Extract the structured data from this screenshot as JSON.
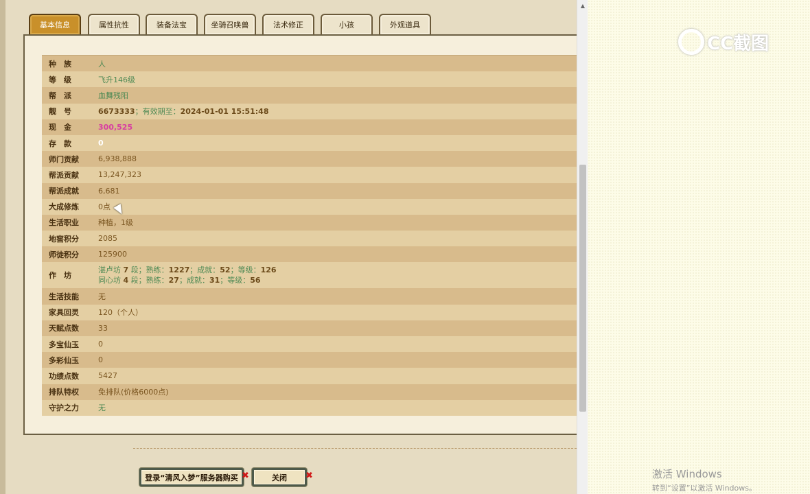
{
  "tabs": [
    {
      "label": "基本信息",
      "active": true
    },
    {
      "label": "属性抗性",
      "active": false
    },
    {
      "label": "装备法宝",
      "active": false
    },
    {
      "label": "坐骑召唤兽",
      "active": false
    },
    {
      "label": "法术修正",
      "active": false
    },
    {
      "label": "小孩",
      "active": false
    },
    {
      "label": "外观道具",
      "active": false
    }
  ],
  "info": {
    "race": {
      "label": "种　族",
      "value": "人"
    },
    "level": {
      "label": "等　级",
      "value": "飞升146级"
    },
    "faction": {
      "label": "帮　派",
      "value": "血舞残阳"
    },
    "id": {
      "label": "靓　号",
      "number": "6673333",
      "sep": "；",
      "expiry_label": "有效期至：",
      "expiry": "2024-01-01 15:51:48"
    },
    "cash": {
      "label": "现　金",
      "value": "300,525"
    },
    "deposit": {
      "label": "存　款",
      "value": "0"
    },
    "school_contrib": {
      "label": "师门贡献",
      "value": "6,938,888"
    },
    "faction_contrib": {
      "label": "帮派贡献",
      "value": "13,247,323"
    },
    "faction_achieve": {
      "label": "帮派成就",
      "value": "6,681"
    },
    "cultivation": {
      "label": "大成修炼",
      "value": "0点"
    },
    "life_job": {
      "label": "生活职业",
      "value": "种植，1级"
    },
    "cellar_points": {
      "label": "地窖积分",
      "value": "2085"
    },
    "apprentice_points": {
      "label": "师徒积分",
      "value": "125900"
    },
    "workshop": {
      "label": "作　坊",
      "lines": [
        {
          "name": "湛卢坊",
          "num": "7",
          "seg": "段；熟练：",
          "skill": "1227",
          "ach_label": "；成就：",
          "ach": "52",
          "lvl_label": "；等级：",
          "lvl": "126"
        },
        {
          "name": "同心坊",
          "num": "4",
          "seg": "段；熟练：",
          "skill": "27",
          "ach_label": "；成就：",
          "ach": "31",
          "lvl_label": "；等级：",
          "lvl": "56"
        }
      ]
    },
    "life_skill": {
      "label": "生活技能",
      "value": "无"
    },
    "furniture": {
      "label": "家具回灵",
      "value": "120（个人）"
    },
    "talent": {
      "label": "天赋点数",
      "value": "33"
    },
    "duobao": {
      "label": "多宝仙玉",
      "value": "0"
    },
    "duocai": {
      "label": "多彩仙玉",
      "value": "0"
    },
    "merit": {
      "label": "功绩点数",
      "value": "5427"
    },
    "queue": {
      "label": "排队特权",
      "value": "免排队(价格6000点)"
    },
    "guardian": {
      "label": "守护之力",
      "value": "无"
    }
  },
  "buttons": {
    "login": "登录“清风入梦”服务器购买",
    "close": "关闭",
    "x": "✖"
  },
  "watermark": {
    "logo_text": "CC截图"
  },
  "windows": {
    "line1": "激活 Windows",
    "line2": "转到“设置”以激活 Windows。"
  }
}
